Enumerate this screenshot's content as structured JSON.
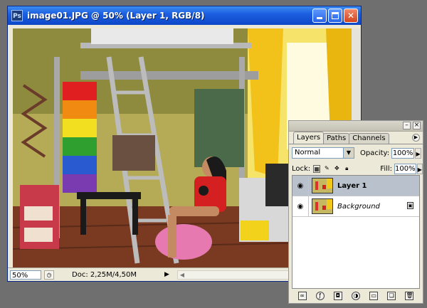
{
  "document": {
    "title": "image01.JPG @ 50% (Layer 1, RGB/8)",
    "zoom": "50%",
    "doc_info": "Doc: 2,25M/4,50M",
    "image": "photo-bedroom-loft-bed"
  },
  "layers_panel": {
    "tabs": [
      "Layers",
      "Paths",
      "Channels"
    ],
    "active_tab": "Layers",
    "blend_mode": "Normal",
    "opacity_label": "Opacity:",
    "opacity": "100%",
    "lock_label": "Lock:",
    "fill_label": "Fill:",
    "fill": "100%",
    "layers": [
      {
        "name": "Layer 1",
        "selected": true,
        "visible": true,
        "locked": false
      },
      {
        "name": "Background",
        "selected": false,
        "visible": true,
        "locked": true
      }
    ]
  },
  "icons": {
    "app": "photoshop-icon",
    "minimize": "minimize-icon",
    "maximize": "maximize-icon",
    "close": "close-icon",
    "eye": "eye-icon",
    "lock": "lock-icon"
  },
  "colors": {
    "titlebar": "#1c5fe0",
    "selected_layer": "#b9c2cc"
  }
}
